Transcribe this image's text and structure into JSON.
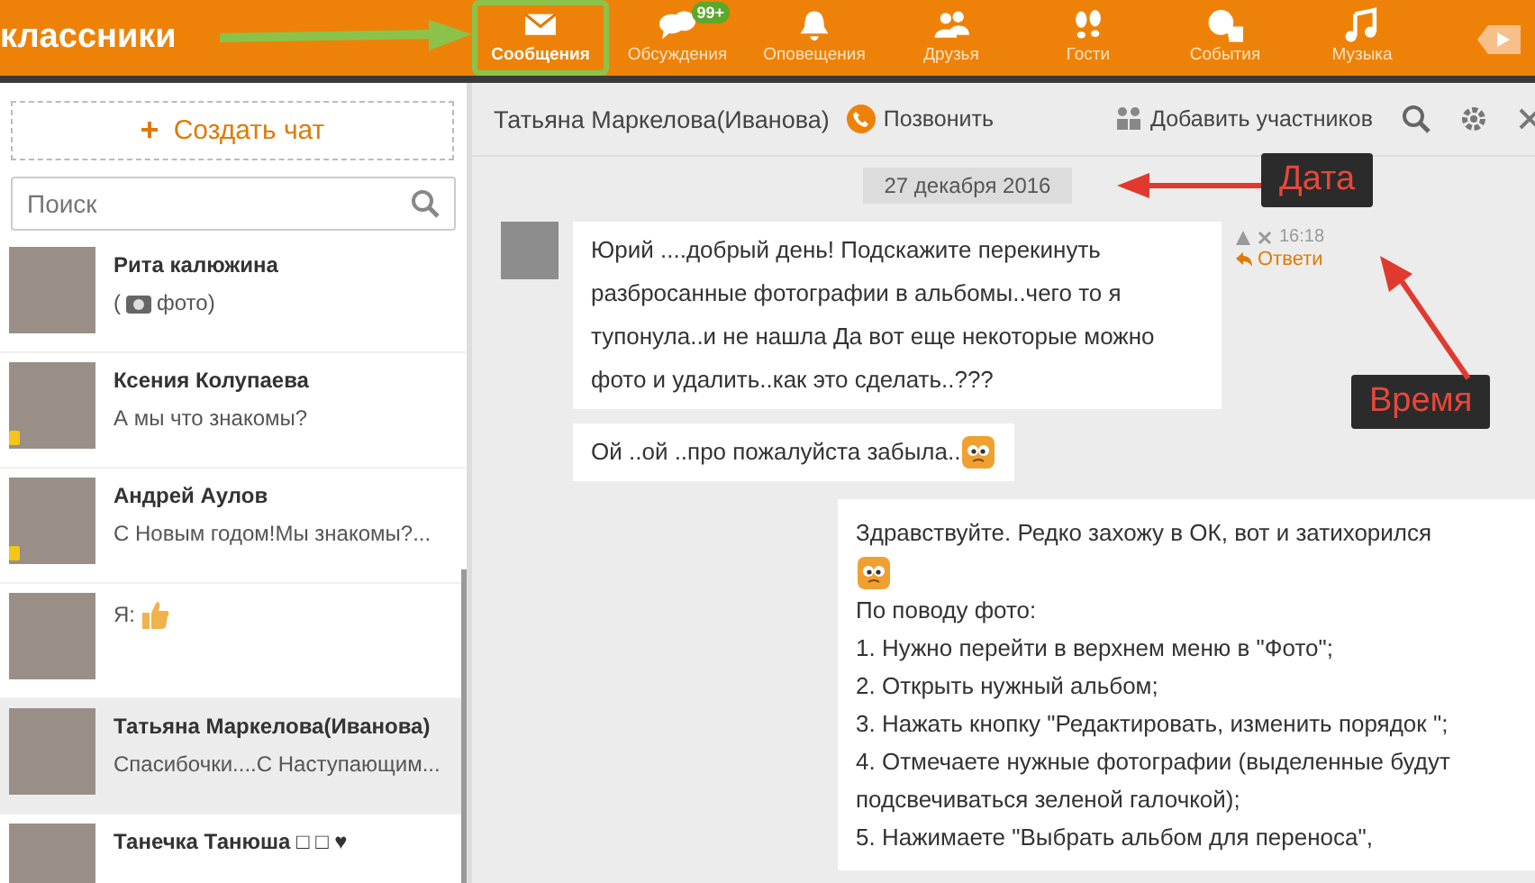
{
  "logo": "классники",
  "nav": [
    {
      "label": "Сообщения",
      "selected": true
    },
    {
      "label": "Обсуждения",
      "selected": false,
      "badge": "99+"
    },
    {
      "label": "Оповещения",
      "selected": false
    },
    {
      "label": "Друзья",
      "selected": false
    },
    {
      "label": "Гости",
      "selected": false
    },
    {
      "label": "События",
      "selected": false
    },
    {
      "label": "Музыка",
      "selected": false
    },
    {
      "selected": false
    }
  ],
  "sidebar": {
    "create_chat_icon": "+",
    "create_chat": "Создать чат",
    "search": {
      "placeholder": "Поиск"
    },
    "chats": [
      {
        "name": "Рита калюжина",
        "preview": "фото)",
        "preview_prefix": "(",
        "attachment": true,
        "mobile": false,
        "selected": false
      },
      {
        "name": "Ксения Колупаева",
        "preview": "А мы что знакомы?",
        "mobile": true,
        "selected": false
      },
      {
        "name": "Андрей Аулов",
        "preview": "С Новым годом!Мы знакомы?...",
        "mobile": true,
        "selected": false
      },
      {
        "preview": "Я:",
        "like": true,
        "mobile": false,
        "selected": false
      },
      {
        "name": "Татьяна Маркелова(Иванова)",
        "preview": "Спасибочки....С Наступающим...",
        "mobile": false,
        "selected": true
      },
      {
        "name": "Танечка Танюша □ □ ♥",
        "mobile": false,
        "selected": false
      }
    ]
  },
  "chat": {
    "title": "Татьяна Маркелова(Иванова)",
    "call": "Позвонить",
    "add_members": "Добавить участников",
    "date": "27 декабря 2016",
    "incoming": {
      "messages": [
        {
          "text": "Юрий ....добрый день! Подскажите перекинуть разбросанные фотографии в альбомы..чего  то я тупонула..и не нашла Да вот еще некоторые можно фото  и удалить..как это сделать..???",
          "emoji": false
        },
        {
          "text": "Ой ..ой ..про пожалуйста забыла..",
          "emoji": true
        }
      ],
      "time": "16:18",
      "reply": "Ответи"
    },
    "outgoing": {
      "lines": [
        {
          "text": "Здравствуйте. Редко захожу в ОК, вот и затихорился",
          "emoji": true
        },
        {
          "text": "По поводу фото:"
        },
        {
          "text": "1. Нужно перейти в верхнем меню в \"Фото\";"
        },
        {
          "text": "2. Открыть нужный альбом;"
        },
        {
          "text": "3. Нажать кнопку \"Редактировать, изменить порядок \";"
        },
        {
          "text": "4. Отмечаете нужные фотографии (выделенные будут подсвечиваться зеленой галочкой);"
        },
        {
          "text": "5. Нажимаете \"Выбрать альбом для переноса\","
        }
      ]
    }
  },
  "annotations": [
    {
      "kind": "date",
      "text": "Дата"
    },
    {
      "kind": "time",
      "text": "Время"
    }
  ]
}
